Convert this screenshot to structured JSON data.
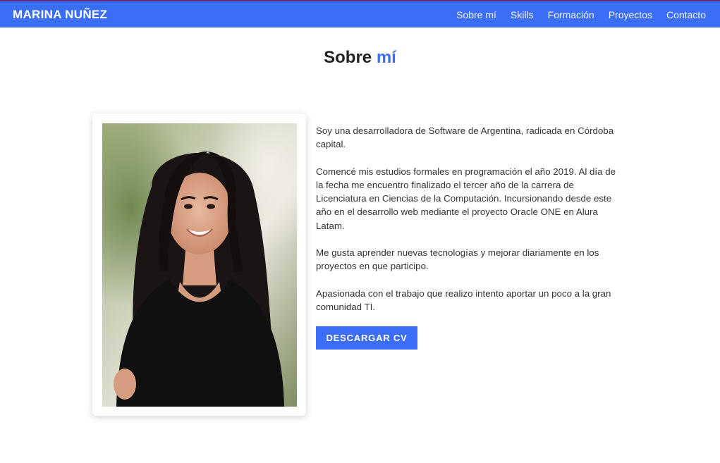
{
  "navbar": {
    "brand": "MARINA NUÑEZ",
    "links": [
      "Sobre mí",
      "Skills",
      "Formación",
      "Proyectos",
      "Contacto"
    ]
  },
  "about": {
    "title_main": "Sobre",
    "title_accent": "mí",
    "paragraphs": [
      "Soy una desarrolladora de Software de Argentina, radicada en Córdoba capital.",
      "Comencé mis estudios formales en programación el año 2019. Al día de la fecha me encuentro finalizado el tercer año de la carrera de Licenciatura en Ciencias de la Computación. Incursionando desde este año en el desarrollo web mediante el proyecto Oracle ONE en Alura Latam.",
      "Me gusta aprender nuevas tecnologías y mejorar diariamente en los proyectos en que participo.",
      "Apasionada con el trabajo que realizo intento aportar un poco a la gran comunidad TI."
    ],
    "cv_button": "DESCARGAR CV"
  },
  "colors": {
    "accent": "#3b6ef5",
    "navbar_bg": "#3b6ef5",
    "text": "#333333"
  }
}
